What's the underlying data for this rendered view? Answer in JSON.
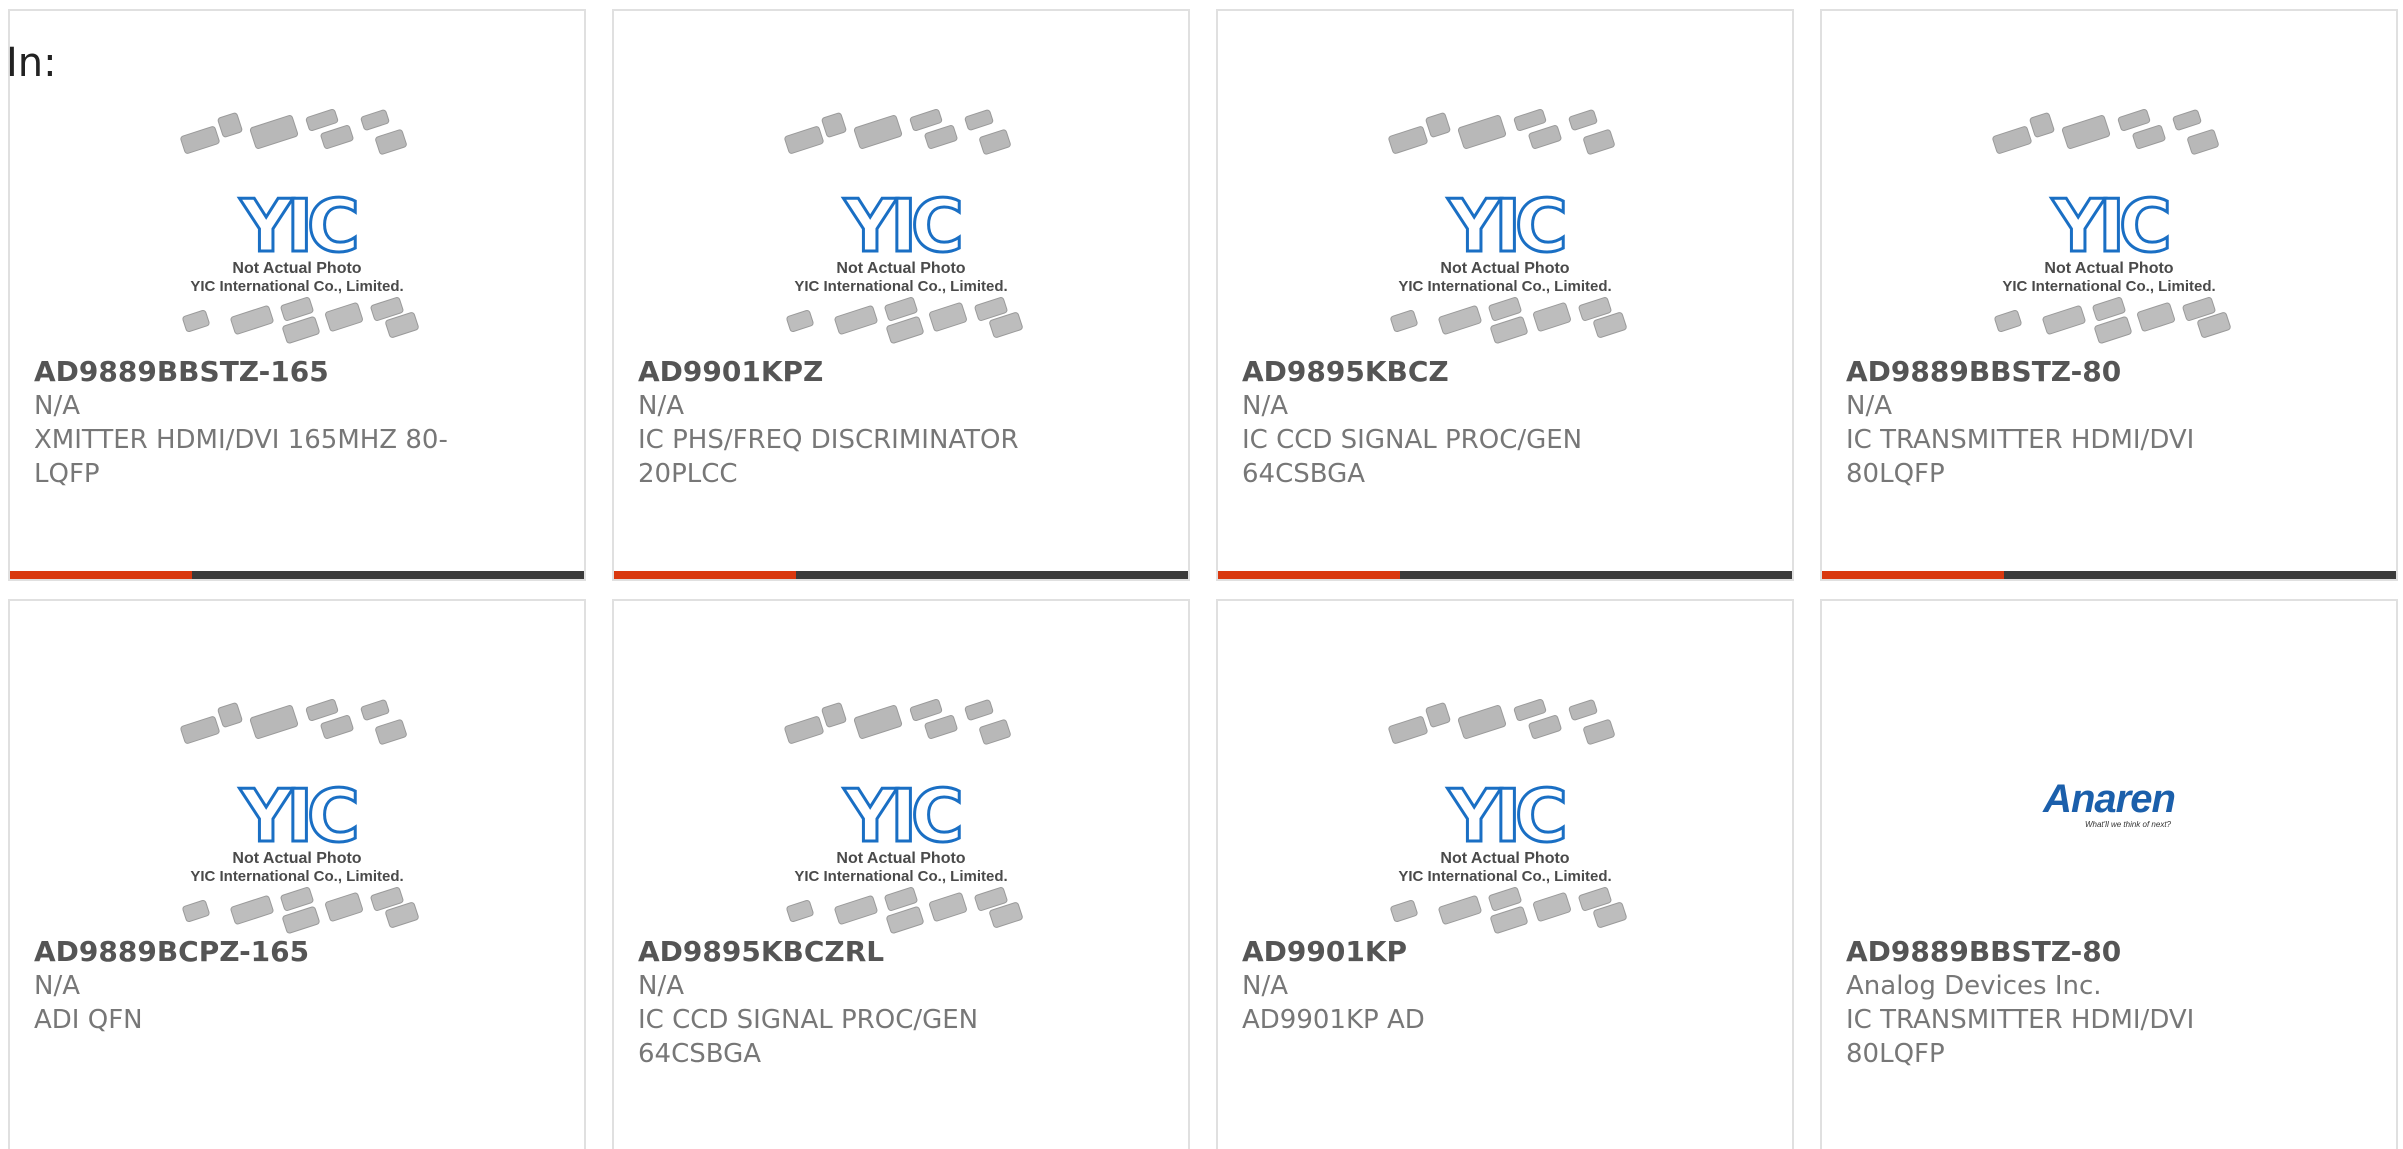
{
  "header": {
    "label": "In:"
  },
  "colors": {
    "accent": "#d9380f",
    "bar": "#3a3a3a",
    "yic_blue": "#1a6fc4",
    "anaren_blue": "#1b5fab"
  },
  "placeholder": {
    "icon": "yic-not-actual-photo",
    "logo_text": "YIC",
    "line1": "Not Actual Photo",
    "line2": "YIC International Co., Limited."
  },
  "anaren": {
    "icon": "anaren-logo",
    "logo_text": "Anaren",
    "tagline": "What'll we think of next?"
  },
  "products": [
    {
      "part": "AD9889BBSTZ-165",
      "manufacturer": "N/A",
      "desc1": "XMITTER HDMI/DVI 165MHZ 80-",
      "desc2": "LQFP"
    },
    {
      "part": "AD9901KPZ",
      "manufacturer": "N/A",
      "desc1": "IC PHS/FREQ DISCRIMINATOR",
      "desc2": "20PLCC"
    },
    {
      "part": "AD9895KBCZ",
      "manufacturer": "N/A",
      "desc1": "IC CCD SIGNAL PROC/GEN",
      "desc2": "64CSBGA"
    },
    {
      "part": "AD9889BBSTZ-80",
      "manufacturer": "N/A",
      "desc1": "IC TRANSMITTER HDMI/DVI",
      "desc2": "80LQFP"
    },
    {
      "part": "AD9889BCPZ-165",
      "manufacturer": "N/A",
      "desc1": "ADI QFN",
      "desc2": ""
    },
    {
      "part": "AD9895KBCZRL",
      "manufacturer": "N/A",
      "desc1": "IC CCD SIGNAL PROC/GEN",
      "desc2": "64CSBGA"
    },
    {
      "part": "AD9901KP",
      "manufacturer": "N/A",
      "desc1": "AD9901KP AD",
      "desc2": ""
    },
    {
      "part": "AD9889BBSTZ-80",
      "manufacturer": "Analog Devices Inc.",
      "desc1": "IC TRANSMITTER HDMI/DVI",
      "desc2": "80LQFP"
    }
  ]
}
